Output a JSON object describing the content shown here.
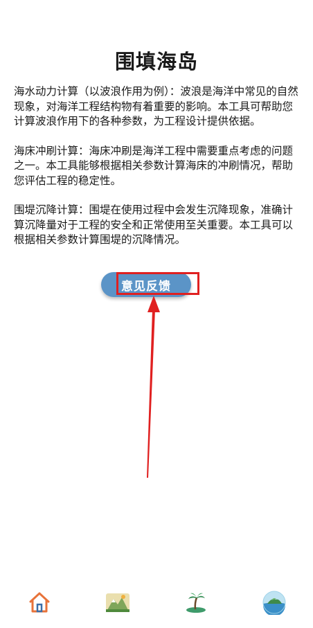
{
  "page": {
    "title": "围填海岛"
  },
  "sections": [
    {
      "text": "海水动力计算（以波浪作用为例）：波浪是海洋中常见的自然现象，对海洋工程结构物有着重要的影响。本工具可帮助您计算波浪作用下的各种参数，为工程设计提供依据。"
    },
    {
      "text": "海床冲刷计算：海床冲刷是海洋工程中需要重点考虑的问题之一。本工具能够根据相关参数计算海床的冲刷情况，帮助您评估工程的稳定性。"
    },
    {
      "text": "围堤沉降计算：围堤在使用过程中会发生沉降现象，准确计算沉降量对于工程的安全和正常使用至关重要。本工具可以根据相关参数计算围堤的沉降情况。"
    }
  ],
  "feedback": {
    "label": "意见反馈"
  },
  "colors": {
    "button": "#5b94c7",
    "highlight": "#e02020",
    "home_icon": "#e8733a"
  },
  "tabbar": {
    "items": [
      {
        "icon": "home-icon"
      },
      {
        "icon": "mountain-icon"
      },
      {
        "icon": "palm-island-icon"
      },
      {
        "icon": "globe-island-icon"
      }
    ]
  }
}
